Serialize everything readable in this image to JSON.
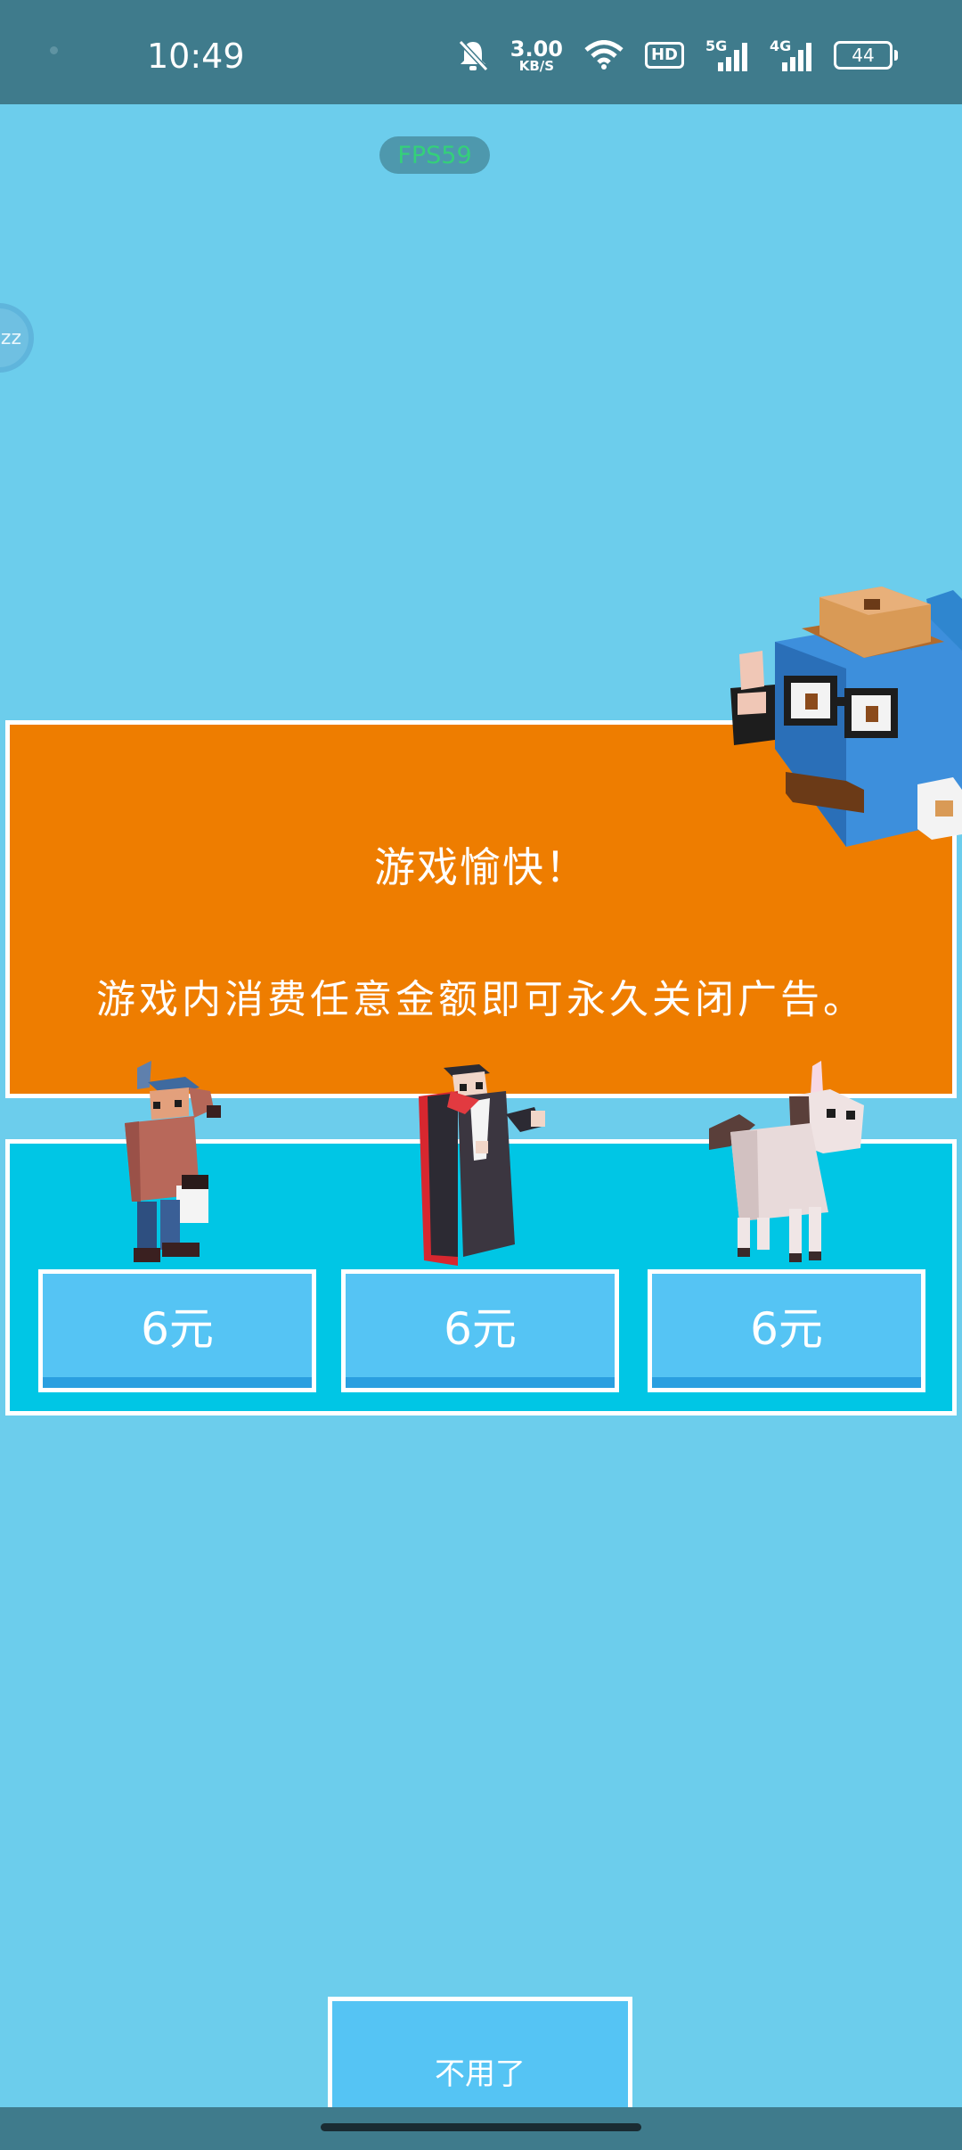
{
  "status_bar": {
    "time": "10:49",
    "net_speed_value": "3.00",
    "net_speed_unit": "KB/S",
    "hd_label": "HD",
    "sim1_label": "5G",
    "sim2_label": "4G",
    "battery": "44"
  },
  "overlay": {
    "fps": "FPS59",
    "float_ball_text": "zz"
  },
  "dialog": {
    "title": "游戏愉快！",
    "message": "游戏内消费任意金额即可永久关闭广告。"
  },
  "offers": [
    {
      "character": "hiker-character",
      "price": "6元"
    },
    {
      "character": "vampire-character",
      "price": "6元"
    },
    {
      "character": "llama-character",
      "price": "6元"
    }
  ],
  "decline_button": "不用了",
  "colors": {
    "background": "#6ccdec",
    "panel_orange": "#ee7d00",
    "panel_cyan": "#00c6e5",
    "button_blue": "#55c4f4",
    "status_bar": "#3f7b8c"
  }
}
